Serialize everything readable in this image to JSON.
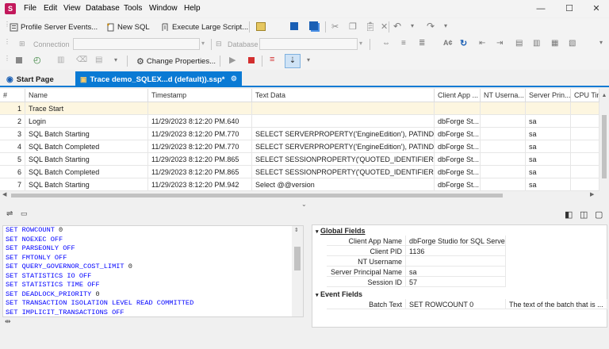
{
  "menu": [
    "File",
    "Edit",
    "View",
    "Database",
    "Tools",
    "Window",
    "Help"
  ],
  "window_controls": {
    "minimize": "—",
    "maximize": "☐",
    "close": "✕"
  },
  "toolbar1": {
    "profile_server_events": "Profile Server Events...",
    "new_sql": "New SQL",
    "execute_large_script": "Execute Large Script..."
  },
  "toolbar2": {
    "connection_label": "Connection",
    "database_label": "Database"
  },
  "toolbar3": {
    "change_properties": "Change Properties..."
  },
  "tabs": [
    {
      "label": "Start Page"
    },
    {
      "label": "Trace demo_SQLEX...d (default)).ssp*"
    }
  ],
  "grid": {
    "columns": [
      "#",
      "Name",
      "Timestamp",
      "Text Data",
      "Client App ...",
      "NT Userna...",
      "Server Prin...",
      "CPU Time"
    ],
    "rows": [
      {
        "n": "1",
        "name": "Trace Start",
        "ts": "",
        "text": "",
        "app": "",
        "nt": "",
        "sp": "",
        "cpu": ""
      },
      {
        "n": "2",
        "name": "Login",
        "ts": "11/29/2023 8:12:20 PM.640",
        "text": "",
        "app": "dbForge St...",
        "nt": "",
        "sp": "sa",
        "cpu": ""
      },
      {
        "n": "3",
        "name": "SQL Batch Starting",
        "ts": "11/29/2023 8:12:20 PM.770",
        "text": "SELECT SERVERPROPERTY('EngineEdition'), PATINDEX('%...",
        "app": "dbForge St...",
        "nt": "",
        "sp": "sa",
        "cpu": ""
      },
      {
        "n": "4",
        "name": "SQL Batch Completed",
        "ts": "11/29/2023 8:12:20 PM.770",
        "text": "SELECT SERVERPROPERTY('EngineEdition'), PATINDEX('%...",
        "app": "dbForge St...",
        "nt": "",
        "sp": "sa",
        "cpu": ""
      },
      {
        "n": "5",
        "name": "SQL Batch Starting",
        "ts": "11/29/2023 8:12:20 PM.865",
        "text": "SELECT SESSIONPROPERTY('QUOTED_IDENTIFIER')",
        "app": "dbForge St...",
        "nt": "",
        "sp": "sa",
        "cpu": ""
      },
      {
        "n": "6",
        "name": "SQL Batch Completed",
        "ts": "11/29/2023 8:12:20 PM.865",
        "text": "SELECT SESSIONPROPERTY('QUOTED_IDENTIFIER')",
        "app": "dbForge St...",
        "nt": "",
        "sp": "sa",
        "cpu": ""
      },
      {
        "n": "7",
        "name": "SQL Batch Starting",
        "ts": "11/29/2023 8:12:20 PM.942",
        "text": "Select @@version",
        "app": "dbForge St...",
        "nt": "",
        "sp": "sa",
        "cpu": ""
      }
    ]
  },
  "code": [
    {
      "kw": "SET ROWCOUNT",
      "rest": " 0"
    },
    {
      "kw": "SET NOEXEC OFF",
      "rest": ""
    },
    {
      "kw": "SET PARSEONLY OFF",
      "rest": ""
    },
    {
      "kw": "SET FMTONLY OFF",
      "rest": ""
    },
    {
      "kw": "SET QUERY_GOVERNOR_COST_LIMIT",
      "rest": " 0"
    },
    {
      "kw": "SET STATISTICS IO OFF",
      "rest": ""
    },
    {
      "kw": "SET STATISTICS TIME OFF",
      "rest": ""
    },
    {
      "kw": "SET DEADLOCK_PRIORITY",
      "rest": " 0"
    },
    {
      "kw": "SET TRANSACTION ISOLATION LEVEL READ COMMITTED",
      "rest": ""
    },
    {
      "kw": "SET IMPLICIT_TRANSACTIONS OFF",
      "rest": ""
    }
  ],
  "properties": {
    "global_title": "Global Fields",
    "global": [
      {
        "name": "Client App Name",
        "value": "dbForge Studio for SQL Server"
      },
      {
        "name": "Client PID",
        "value": "1136"
      },
      {
        "name": "NT Username",
        "value": ""
      },
      {
        "name": "Server Principal Name",
        "value": "sa"
      },
      {
        "name": "Session ID",
        "value": "57"
      }
    ],
    "event_title": "Event Fields",
    "event": [
      {
        "name": "Batch Text",
        "value": "SET ROWCOUNT 0",
        "desc": "The text of the batch that is ..."
      }
    ]
  },
  "colors": {
    "accent": "#0a7ad4",
    "keyword": "#0000ff",
    "active_tab": "#0a7ad4"
  }
}
